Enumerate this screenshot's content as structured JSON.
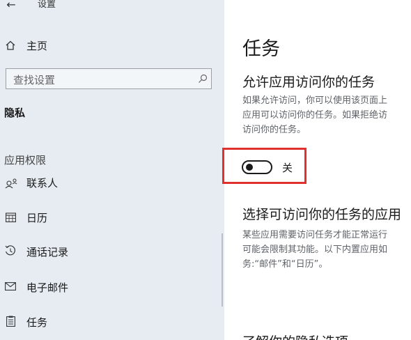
{
  "window": {
    "title": "设置"
  },
  "sidebar": {
    "home_label": "主页",
    "search_placeholder": "查找设置",
    "section_title": "隐私",
    "group_title": "应用权限",
    "items": [
      {
        "label": "联系人",
        "icon": "contacts-icon"
      },
      {
        "label": "日历",
        "icon": "calendar-icon"
      },
      {
        "label": "通话记录",
        "icon": "call-history-icon"
      },
      {
        "label": "电子邮件",
        "icon": "email-icon"
      },
      {
        "label": "任务",
        "icon": "tasks-icon"
      }
    ]
  },
  "main": {
    "title": "任务",
    "section1": {
      "heading": "允许应用访问你的任务",
      "desc_lines": [
        "如果允许访问，你可以使用该页面上",
        "应用可以访问你的任务。如果拒绝访",
        "访问你的任务。"
      ]
    },
    "toggle": {
      "state_label": "关",
      "on": false
    },
    "section2": {
      "heading": "选择可访问你的任务的应用",
      "desc_lines": [
        "某些应用需要访问任务才能正常运行",
        "可能会限制其功能。以下内置应用如",
        "务:“邮件”和“日历”。"
      ]
    },
    "section3_heading": "了解你的隐私选项"
  },
  "colors": {
    "accent_highlight": "#e0312f",
    "sidebar_bg": "#e6ecf2"
  }
}
